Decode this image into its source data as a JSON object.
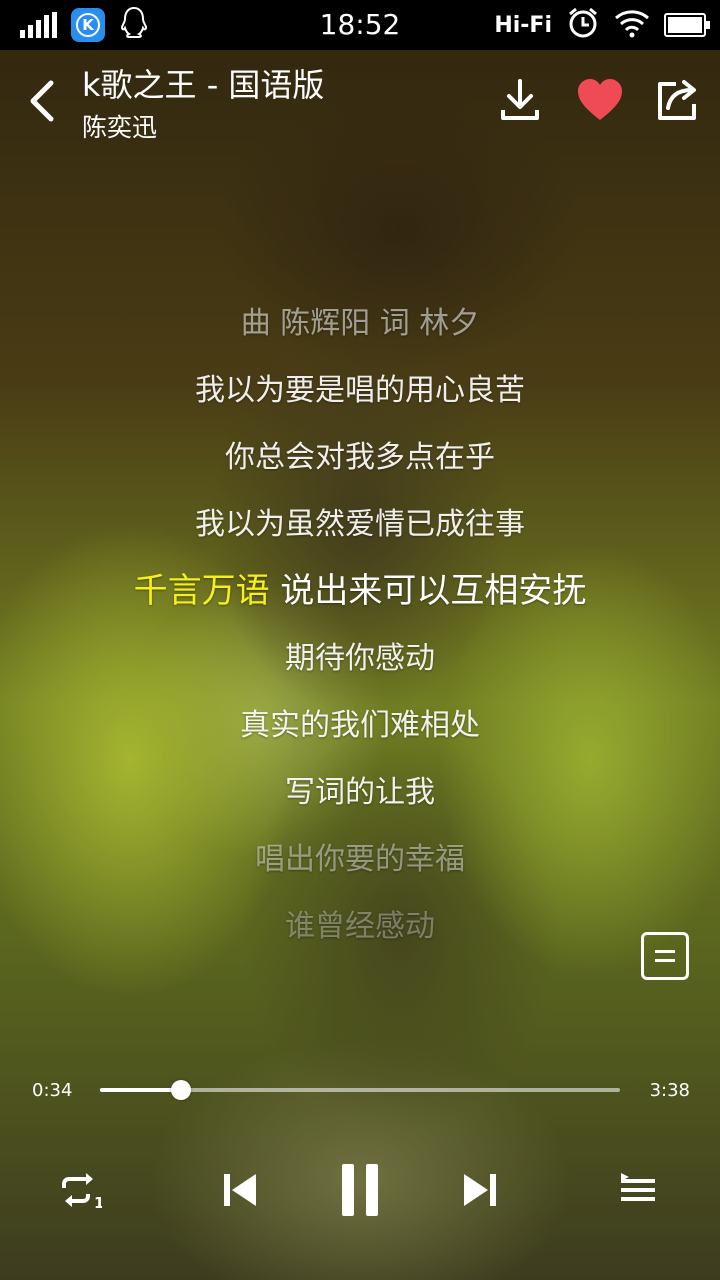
{
  "status_bar": {
    "time": "18:52",
    "hifi_label": "Hi-Fi",
    "icons": [
      "signal-icon",
      "kugou-app-icon",
      "qq-icon",
      "alarm-icon",
      "wifi-icon",
      "battery-icon"
    ],
    "app_badge_letter": "K"
  },
  "header": {
    "song_title": "k歌之王 - 国语版",
    "artist": "陈奕迅",
    "liked": true,
    "like_color": "#ee4b55"
  },
  "lyrics": {
    "lines": [
      "曲 陈辉阳 词 林夕",
      "我以为要是唱的用心良苦",
      "你总会对我多点在乎",
      "我以为虽然爱情已成往事",
      "千言万语 说出来可以互相安抚",
      "期待你感动",
      "真实的我们难相处",
      "写词的让我",
      "唱出你要的幸福",
      "谁曾经感动"
    ],
    "current_index": 4,
    "current_sung": "千言万语",
    "current_rest": " 说出来可以互相安抚",
    "highlight_color": "#f6ef1c"
  },
  "player": {
    "current_time": "0:34",
    "total_time": "3:38",
    "progress": 0.156,
    "repeat_mode": "repeat-one",
    "is_playing": true
  }
}
